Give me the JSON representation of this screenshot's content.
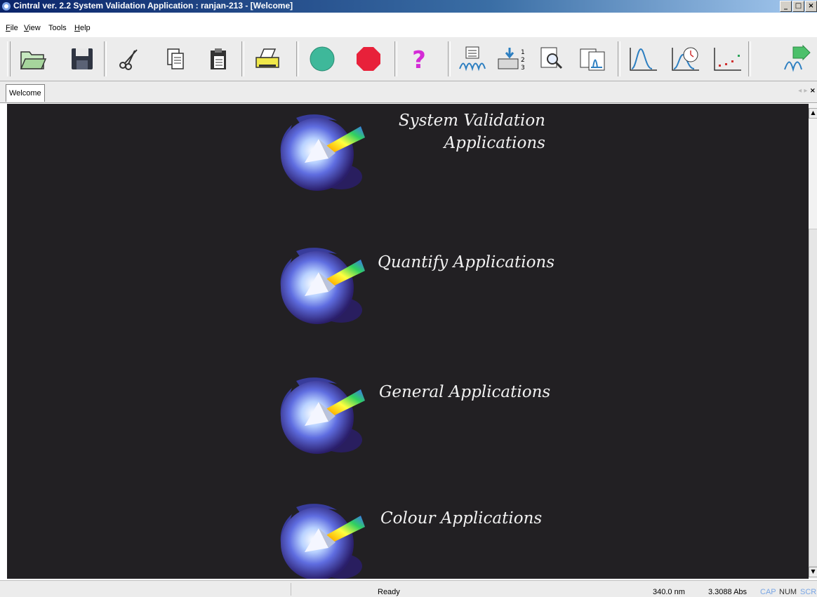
{
  "window": {
    "title": "Cintral ver. 2.2 System Validation Application : ranjan-213 - [Welcome]",
    "controls": [
      "_",
      "□",
      "×"
    ]
  },
  "menu": [
    {
      "label": "File",
      "accel": "F"
    },
    {
      "label": "View",
      "accel": "V"
    },
    {
      "label": "Tools",
      "accel": ""
    },
    {
      "label": "Help",
      "accel": "H"
    }
  ],
  "toolbar": {
    "buttons": [
      "open-folder-icon",
      "save-disk-icon",
      "cut-scissors-icon",
      "copy-icon",
      "paste-icon",
      "print-icon",
      "start-circle-icon",
      "stop-octagon-icon",
      "help-question-icon",
      "scan-report-icon",
      "sample-queue-icon",
      "inspect-zoom-icon",
      "spectrum-doc-icon",
      "spectrum-peak-icon",
      "kinetics-clock-icon",
      "scatter-plot-icon",
      "export-arrow-icon"
    ]
  },
  "tabs": [
    {
      "label": "Welcome"
    }
  ],
  "tab_nav": {
    "prev": "◂",
    "next": "▸",
    "close": "×"
  },
  "apps": [
    {
      "label": "System Validation\nApplications"
    },
    {
      "label": "Quantify Applications"
    },
    {
      "label": "General Applications"
    },
    {
      "label": "Colour Applications"
    }
  ],
  "status": {
    "message": "Ready",
    "wavelength": "340.0 nm",
    "absorbance": "3.3088 Abs",
    "indicators": [
      "CAP",
      "NUM",
      "SCR"
    ]
  },
  "colors": {
    "content_bg": "#222023",
    "title_gradient": "#0a246a",
    "label_text": "#f2f2f2"
  }
}
